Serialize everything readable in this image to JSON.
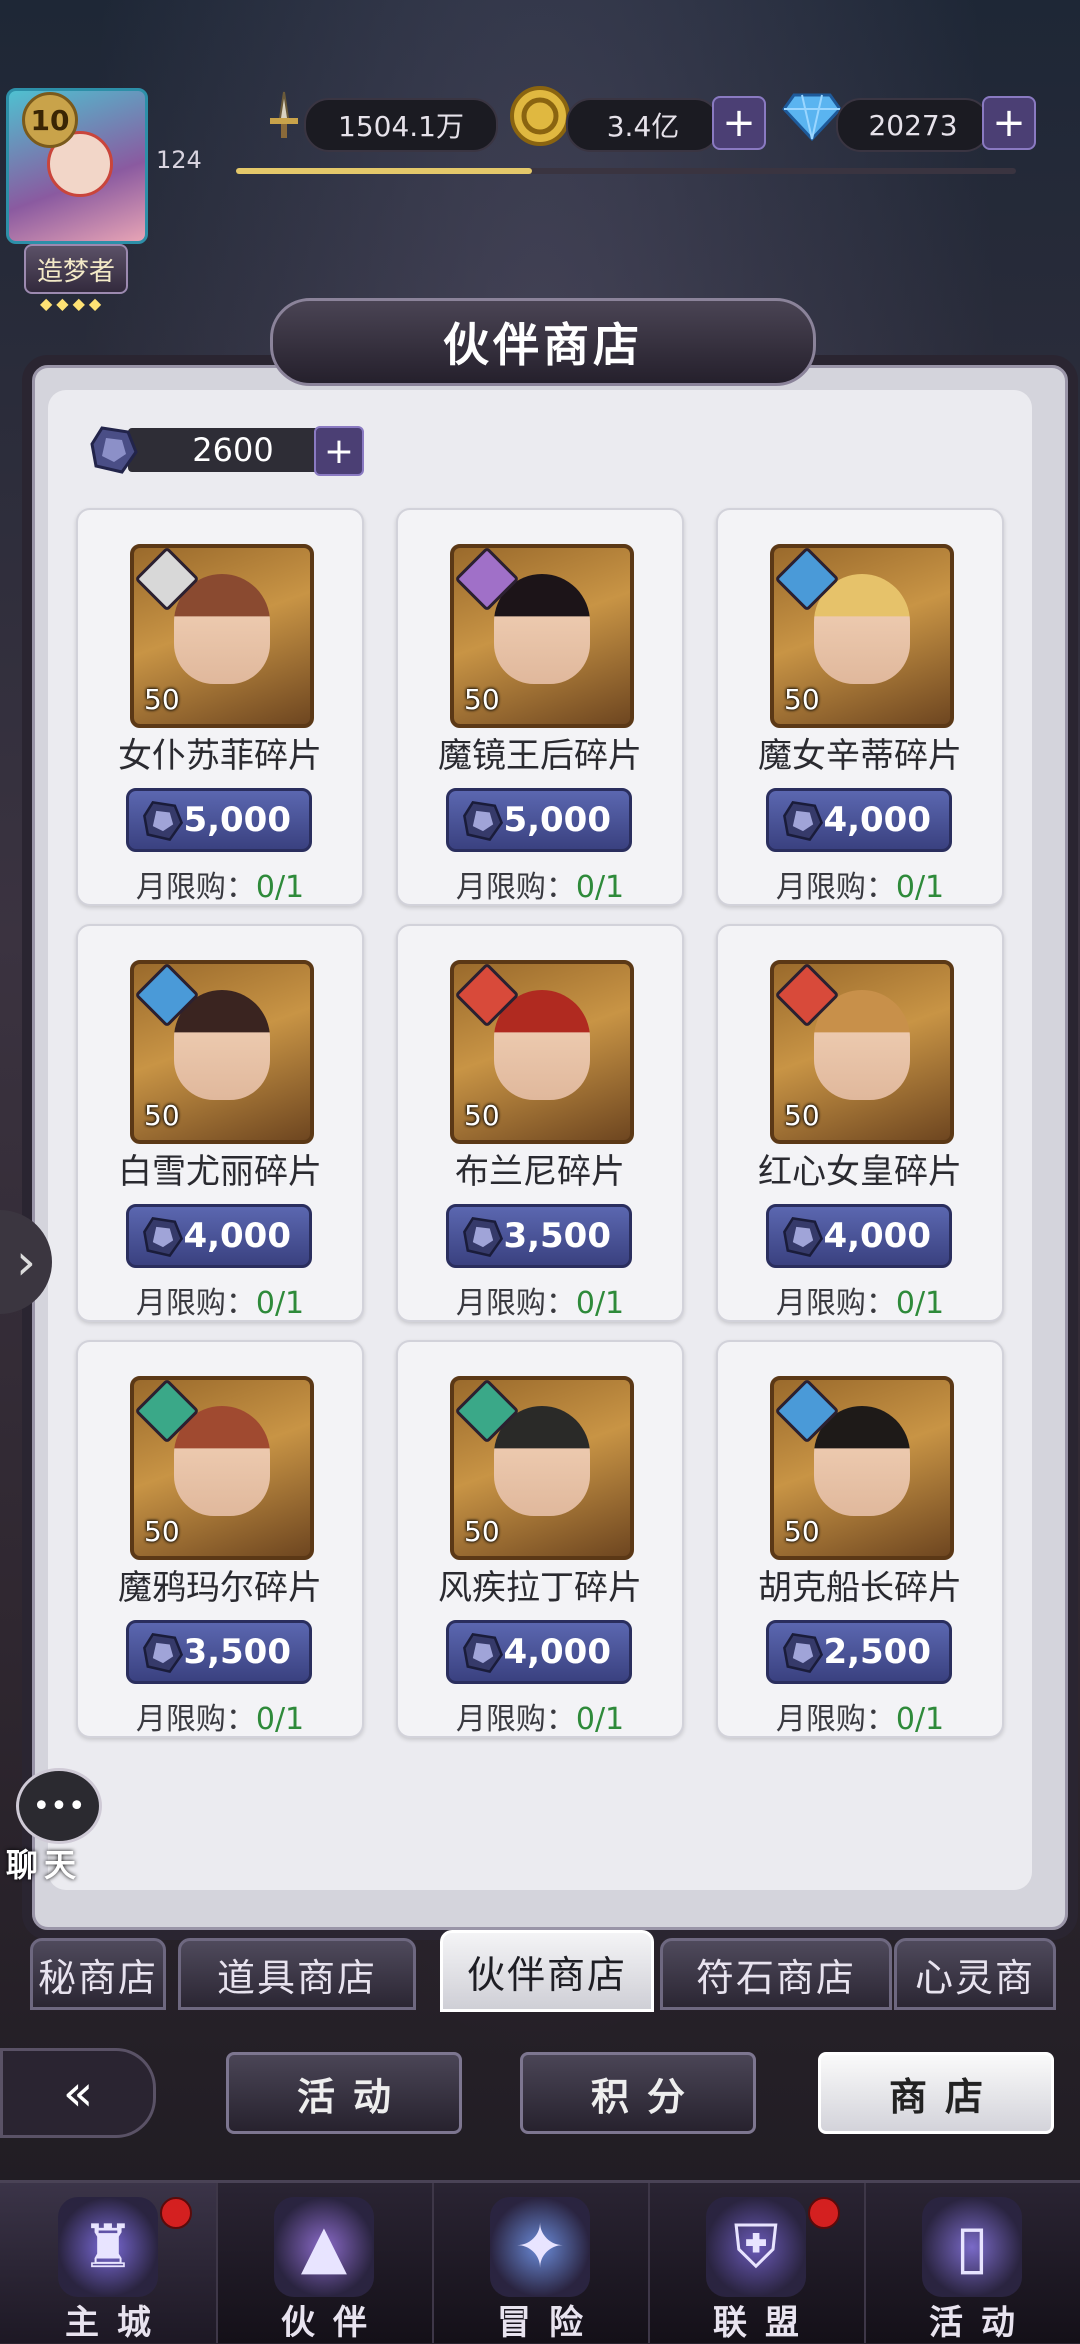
{
  "player": {
    "level_badge": "10",
    "level_number": "124",
    "title": "造梦者",
    "stars": "◆◆◆◆",
    "exp_progress": 0.38
  },
  "resources": {
    "power": "1504.1万",
    "gold": "3.4亿",
    "diamond": "20273"
  },
  "shop": {
    "title": "伙伴商店",
    "currency_amount": "2600",
    "items": [
      {
        "name": "女仆苏菲碎片",
        "count": "50",
        "price": "5,000",
        "limit_label": "月限购：",
        "limit_value": "0/1",
        "elem_color": "#d8d8d8",
        "hair": "#8a4a30"
      },
      {
        "name": "魔镜王后碎片",
        "count": "50",
        "price": "5,000",
        "limit_label": "月限购：",
        "limit_value": "0/1",
        "elem_color": "#a070c8",
        "hair": "#1c1418"
      },
      {
        "name": "魔女辛蒂碎片",
        "count": "50",
        "price": "4,000",
        "limit_label": "月限购：",
        "limit_value": "0/1",
        "elem_color": "#4a9ad8",
        "hair": "#e6c26a"
      },
      {
        "name": "白雪尤丽碎片",
        "count": "50",
        "price": "4,000",
        "limit_label": "月限购：",
        "limit_value": "0/1",
        "elem_color": "#4a9ad8",
        "hair": "#3a2420"
      },
      {
        "name": "布兰尼碎片",
        "count": "50",
        "price": "3,500",
        "limit_label": "月限购：",
        "limit_value": "0/1",
        "elem_color": "#d84a3a",
        "hair": "#b02a20"
      },
      {
        "name": "红心女皇碎片",
        "count": "50",
        "price": "4,000",
        "limit_label": "月限购：",
        "limit_value": "0/1",
        "elem_color": "#d84a3a",
        "hair": "#c8904a"
      },
      {
        "name": "魔鸦玛尔碎片",
        "count": "50",
        "price": "3,500",
        "limit_label": "月限购：",
        "limit_value": "0/1",
        "elem_color": "#3aa888",
        "hair": "#a04a30"
      },
      {
        "name": "风疾拉丁碎片",
        "count": "50",
        "price": "4,000",
        "limit_label": "月限购：",
        "limit_value": "0/1",
        "elem_color": "#3aa888",
        "hair": "#2a2a28"
      },
      {
        "name": "胡克船长碎片",
        "count": "50",
        "price": "2,500",
        "limit_label": "月限购：",
        "limit_value": "0/1",
        "elem_color": "#4a9ad8",
        "hair": "#1e1a18"
      }
    ]
  },
  "tabs": [
    {
      "label": "秘商店",
      "active": false
    },
    {
      "label": "道具商店",
      "active": false
    },
    {
      "label": "伙伴商店",
      "active": true
    },
    {
      "label": "符石商店",
      "active": false
    },
    {
      "label": "心灵商",
      "active": false
    }
  ],
  "subnav": {
    "back_icon": "back-arrow-icon",
    "buttons": [
      {
        "label": "活动",
        "active": false
      },
      {
        "label": "积分",
        "active": false
      },
      {
        "label": "商店",
        "active": true
      }
    ]
  },
  "bottom_nav": [
    {
      "label": "主城",
      "icon": "castle-icon",
      "active": true,
      "dot": true,
      "color": "#7a6ad8"
    },
    {
      "label": "伙伴",
      "icon": "witch-hat-icon",
      "active": false,
      "dot": false,
      "color": "#8a6ac8"
    },
    {
      "label": "冒险",
      "icon": "compass-icon",
      "active": false,
      "dot": false,
      "color": "#6a8ad8"
    },
    {
      "label": "联盟",
      "icon": "shield-icon",
      "active": false,
      "dot": true,
      "color": "#6a5ab8"
    },
    {
      "label": "活动",
      "icon": "cards-icon",
      "active": false,
      "dot": false,
      "color": "#7a6ac8"
    }
  ],
  "chat": {
    "label": "聊天"
  },
  "colors": {
    "accent": "#4b3f74",
    "price_bg": "#3a4180",
    "limit_ok": "#2e8a3a"
  }
}
